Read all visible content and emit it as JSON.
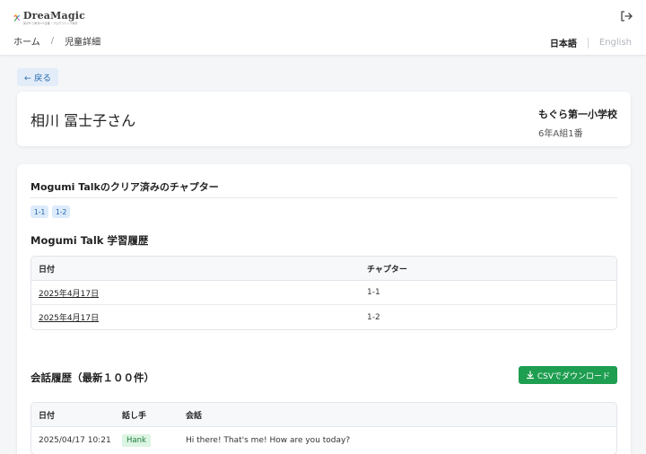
{
  "header": {
    "logo_name": "DreaMagic",
    "logo_sub": "夢が叶う教育ICT企業／プログラミング教育",
    "logout_icon": "logout-icon"
  },
  "breadcrumb": {
    "home": "ホーム",
    "separator": "/",
    "current": "児童詳細"
  },
  "language": {
    "japanese": "日本語",
    "english": "English"
  },
  "back_button": "← 戻る",
  "student": {
    "name": "相川 冨士子さん",
    "school": "もぐら第一小学校",
    "class_info": "6年A組1番"
  },
  "cleared_chapters": {
    "title": "Mogumi Talkのクリア済みのチャプター",
    "chips": [
      "1-1",
      "1-2"
    ]
  },
  "learning_history": {
    "title": "Mogumi Talk 学習履歴",
    "columns": [
      "日付",
      "チャプター"
    ],
    "rows": [
      {
        "date": "2025年4月17日",
        "chapter": "1-1"
      },
      {
        "date": "2025年4月17日",
        "chapter": "1-2"
      }
    ]
  },
  "conversation_history": {
    "title": "会話履歴（最新１００件）",
    "csv_button": "CSVでダウンロード",
    "columns": [
      "日付",
      "話し手",
      "会話"
    ],
    "rows": [
      {
        "date": "2025/04/17 10:21",
        "speaker": "Hank",
        "message": "Hi there! That's me! How are you today?"
      }
    ]
  },
  "colors": {
    "accent_blue": "#2b6cb0",
    "csv_green": "#1e9e50",
    "chip_bg": "#dcebfb"
  }
}
